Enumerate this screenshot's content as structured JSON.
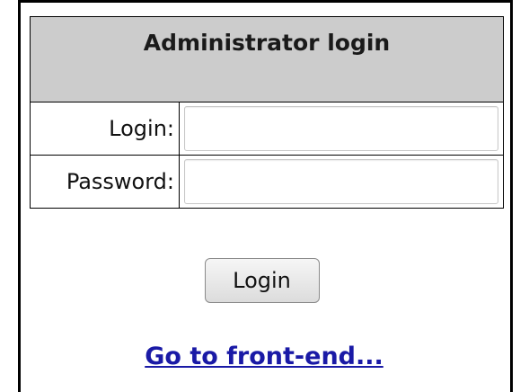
{
  "form": {
    "title": "Administrator login",
    "login_label": "Login:",
    "login_value": "",
    "password_label": "Password:",
    "password_value": "",
    "submit_label": "Login"
  },
  "footer": {
    "link_text": "Go to front-end..."
  },
  "colors": {
    "header_bg": "#cccccc",
    "link": "#1a1aa6",
    "border": "#000000"
  }
}
